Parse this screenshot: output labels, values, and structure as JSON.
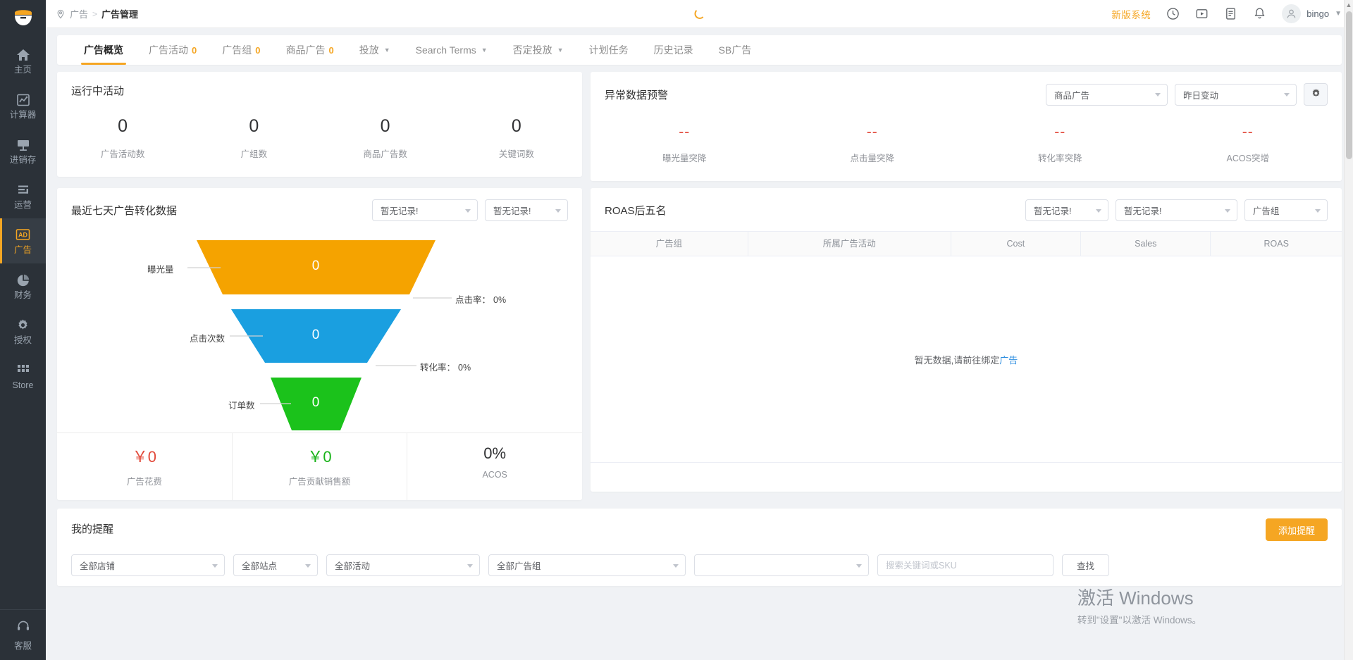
{
  "sidebar": {
    "logo": "app-logo",
    "items": [
      {
        "label": "主页",
        "icon": "home-icon",
        "active": false
      },
      {
        "label": "计算器",
        "icon": "chart-line-icon",
        "active": false
      },
      {
        "label": "进销存",
        "icon": "inventory-icon",
        "active": false
      },
      {
        "label": "运营",
        "icon": "bars-icon",
        "active": false
      },
      {
        "label": "广告",
        "icon": "ad-icon",
        "active": true
      },
      {
        "label": "财务",
        "icon": "pie-chart-icon",
        "active": false
      },
      {
        "label": "授权",
        "icon": "gear-icon",
        "active": false
      },
      {
        "label": "Store",
        "icon": "grid-icon",
        "active": false
      }
    ],
    "support": {
      "label": "客服",
      "icon": "headset-icon"
    }
  },
  "topbar": {
    "breadcrumb": {
      "pin_icon": "location-pin-icon",
      "parent": "广告",
      "separator": ">",
      "current": "广告管理"
    },
    "new_version": "新版系统",
    "icons": [
      "clock-icon",
      "video-play-icon",
      "document-icon",
      "bell-icon"
    ],
    "user": {
      "name": "bingo",
      "avatar_icon": "user-avatar-icon",
      "caret": "chevron-down-icon"
    }
  },
  "tabs": [
    {
      "label": "广告概览",
      "badge": "",
      "caret": false,
      "active": true
    },
    {
      "label": "广告活动",
      "badge": "0",
      "caret": false,
      "active": false
    },
    {
      "label": "广告组",
      "badge": "0",
      "caret": false,
      "active": false
    },
    {
      "label": "商品广告",
      "badge": "0",
      "caret": false,
      "active": false
    },
    {
      "label": "投放",
      "badge": "",
      "caret": true,
      "active": false
    },
    {
      "label": "Search Terms",
      "badge": "",
      "caret": true,
      "active": false
    },
    {
      "label": "否定投放",
      "badge": "",
      "caret": true,
      "active": false
    },
    {
      "label": "计划任务",
      "badge": "",
      "caret": false,
      "active": false
    },
    {
      "label": "历史记录",
      "badge": "",
      "caret": false,
      "active": false
    },
    {
      "label": "SB广告",
      "badge": "",
      "caret": false,
      "active": false
    }
  ],
  "running_campaigns": {
    "title": "运行中活动",
    "kpis": [
      {
        "value": "0",
        "label": "广告活动数"
      },
      {
        "value": "0",
        "label": "广组数"
      },
      {
        "value": "0",
        "label": "商品广告数"
      },
      {
        "value": "0",
        "label": "关键词数"
      }
    ]
  },
  "anomaly_alert": {
    "title": "异常数据预警",
    "filters": [
      {
        "value": "商品广告",
        "name": "ad-type-select"
      },
      {
        "value": "昨日变动",
        "name": "period-select"
      }
    ],
    "settings_icon": "gear-icon",
    "kpis": [
      {
        "value": "--",
        "label": "曝光量突降"
      },
      {
        "value": "--",
        "label": "点击量突降"
      },
      {
        "value": "--",
        "label": "转化率突降"
      },
      {
        "value": "--",
        "label": "ACOS突增"
      }
    ]
  },
  "funnel_card": {
    "title": "最近七天广告转化数据",
    "filters": [
      {
        "value": "暂无记录!",
        "name": "shop-select"
      },
      {
        "value": "暂无记录!",
        "name": "site-select"
      }
    ],
    "stats": [
      {
        "value": "￥0",
        "label": "广告花费",
        "color": "red"
      },
      {
        "value": "￥0",
        "label": "广告贡献销售额",
        "color": "green"
      },
      {
        "value": "0%",
        "label": "ACOS",
        "color": "dark"
      }
    ]
  },
  "roas_card": {
    "title": "ROAS后五名",
    "filters": [
      {
        "value": "暂无记录!",
        "name": "roas-shop-select"
      },
      {
        "value": "暂无记录!",
        "name": "roas-site-select"
      },
      {
        "value": "广告组",
        "name": "roas-dimension-select"
      }
    ],
    "columns": [
      "广告组",
      "所属广告活动",
      "Cost",
      "Sales",
      "ROAS"
    ],
    "empty_text": "暂无数据,请前往绑定",
    "empty_link": "广告",
    "rows": []
  },
  "reminder": {
    "title": "我的提醒",
    "add_button": "添加提醒",
    "filters": [
      {
        "value": "全部店铺",
        "name": "shop-filter"
      },
      {
        "value": "全部站点",
        "name": "site-filter"
      },
      {
        "value": "全部活动",
        "name": "campaign-filter"
      },
      {
        "value": "全部广告组",
        "name": "adgroup-filter"
      },
      {
        "value": "",
        "name": "extra-filter"
      }
    ],
    "search_placeholder": "搜索关键词或SKU",
    "search_value": "",
    "find_button": "查找"
  },
  "watermark": {
    "line1": "激活 Windows",
    "line2": "转到\"设置\"以激活 Windows。"
  },
  "chart_data": {
    "type": "funnel",
    "title": "最近七天广告转化数据",
    "stages": [
      {
        "label": "曝光量",
        "value": 0,
        "color": "#f5a300",
        "display": "0"
      },
      {
        "label": "点击次数",
        "value": 0,
        "color": "#1a9fe0",
        "display": "0"
      },
      {
        "label": "订单数",
        "value": 0,
        "color": "#1bc21b",
        "display": "0"
      }
    ],
    "conversions": [
      {
        "label": "点击率：",
        "value": "0%"
      },
      {
        "label": "转化率：",
        "value": "0%"
      }
    ]
  }
}
